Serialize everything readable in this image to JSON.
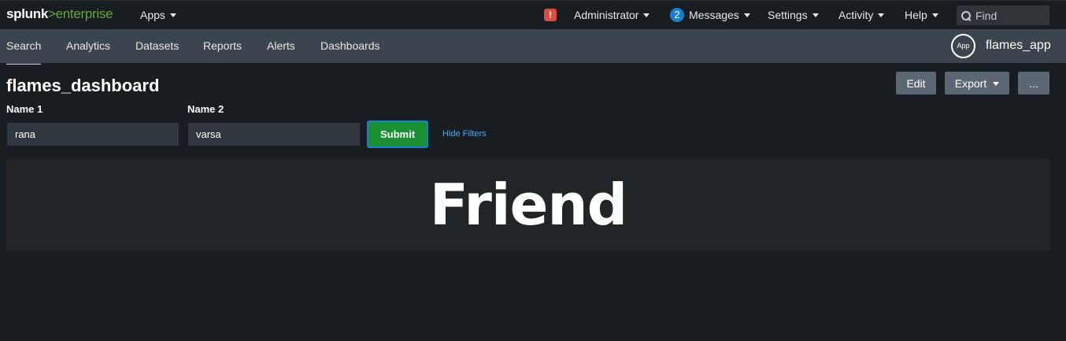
{
  "logo": {
    "brand": "splunk",
    "product": ">enterprise"
  },
  "topnav": {
    "apps": "Apps",
    "alert_glyph": "!",
    "administrator": "Administrator",
    "messages_count": "2",
    "messages": "Messages",
    "settings": "Settings",
    "activity": "Activity",
    "help": "Help",
    "find_placeholder": "Find"
  },
  "appnav": {
    "items": [
      "Search",
      "Analytics",
      "Datasets",
      "Reports",
      "Alerts",
      "Dashboards"
    ],
    "app_badge": "App",
    "app_name": "flames_app"
  },
  "dashboard": {
    "title": "flames_dashboard",
    "edit_label": "Edit",
    "export_label": "Export",
    "more_label": "...",
    "inputs": [
      {
        "label": "Name 1",
        "value": "rana"
      },
      {
        "label": "Name 2",
        "value": "varsa"
      }
    ],
    "submit_label": "Submit",
    "hide_filters_label": "Hide Filters",
    "result_value": "Friend"
  },
  "colors": {
    "background": "#171d21",
    "appbar": "#3c444d",
    "accent_green": "#1a9035",
    "link_blue": "#4ea9f5",
    "alert_red": "#dc4e41"
  }
}
